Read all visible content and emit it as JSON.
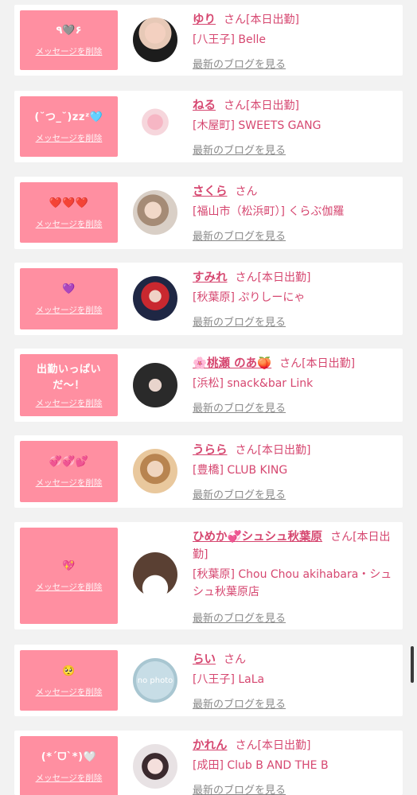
{
  "delete_label": "メッセージを削除",
  "blog_label": "最新のブログを見る",
  "san_label": "さん",
  "cards": [
    {
      "message": "٩🩶۶",
      "name": "ゆり",
      "status": "[本日出勤]",
      "shop": "[八王子] Belle",
      "avatar_icon": "photo-avatar"
    },
    {
      "message": "(˘つ_˘)zzᶻ🩵",
      "name": "ねる",
      "status": "[本日出勤]",
      "shop": "[木屋町] SWEETS GANG",
      "avatar_icon": "photo-avatar"
    },
    {
      "message": "❤️❤️❤️",
      "name": "さくら",
      "status": "",
      "shop": "[福山市（松浜町）] くらぶ伽羅",
      "avatar_icon": "photo-avatar"
    },
    {
      "message": "💜",
      "name": "すみれ",
      "status": "[本日出勤]",
      "shop": "[秋葉原] ぷりしーにゃ",
      "avatar_icon": "photo-avatar"
    },
    {
      "message": "出勤いっぱい\nだ〜！",
      "name": "🌸桃瀬 のあ🍑",
      "status": "[本日出勤]",
      "shop": "[浜松] snack&bar Link",
      "avatar_icon": "photo-avatar"
    },
    {
      "message": "💞💞💕",
      "name": "うらら",
      "status": "[本日出勤]",
      "shop": "[豊橋] CLUB KING",
      "avatar_icon": "photo-avatar"
    },
    {
      "message": "💖",
      "name": "ひめか💞シュシュ秋葉原",
      "status": "[本日出勤]",
      "shop": "[秋葉原] Chou Chou akihabara・シュシュ秋葉原店",
      "avatar_icon": "photo-avatar"
    },
    {
      "message": "🥺",
      "name": "らい",
      "status": "",
      "shop": "[八王子] LaLa",
      "avatar_icon": "no-photo-avatar",
      "avatar_text": "no photo"
    },
    {
      "message": "(*ˊᗜˋ*)🤍",
      "name": "かれん",
      "status": "[本日出勤]",
      "shop": "[成田] Club B AND THE B",
      "avatar_icon": "photo-avatar"
    }
  ]
}
